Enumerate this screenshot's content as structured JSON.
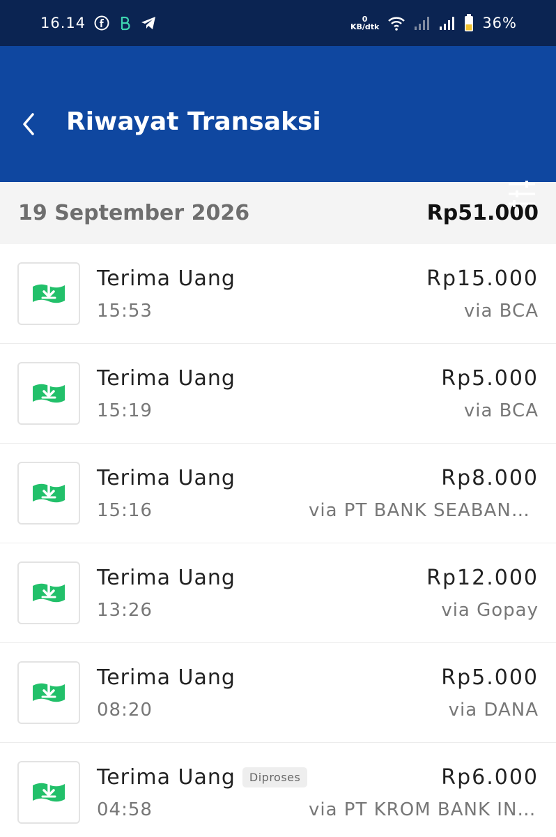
{
  "status_bar": {
    "time": "16.14",
    "net_speed_value": "0",
    "net_speed_unit": "KB/dtk",
    "battery_percent": "36%"
  },
  "app_bar": {
    "title": "Riwayat Transaksi"
  },
  "group": {
    "date": "19 September 2026",
    "total": "Rp51.000"
  },
  "transactions": [
    {
      "title": "Terima Uang",
      "time": "15:53",
      "amount": "Rp15.000",
      "via": "via BCA",
      "badge": ""
    },
    {
      "title": "Terima Uang",
      "time": "15:19",
      "amount": "Rp5.000",
      "via": "via BCA",
      "badge": ""
    },
    {
      "title": "Terima Uang",
      "time": "15:16",
      "amount": "Rp8.000",
      "via": "via PT BANK SEABANK I...",
      "badge": ""
    },
    {
      "title": "Terima Uang",
      "time": "13:26",
      "amount": "Rp12.000",
      "via": "via Gopay",
      "badge": ""
    },
    {
      "title": "Terima Uang",
      "time": "08:20",
      "amount": "Rp5.000",
      "via": "via DANA",
      "badge": ""
    },
    {
      "title": "Terima Uang",
      "time": "04:58",
      "amount": "Rp6.000",
      "via": "via PT KROM BANK IND...",
      "badge": "Diproses"
    }
  ],
  "colors": {
    "status_bar": "#0b2452",
    "app_bar": "#0f47a0",
    "icon_green": "#22c06a"
  }
}
